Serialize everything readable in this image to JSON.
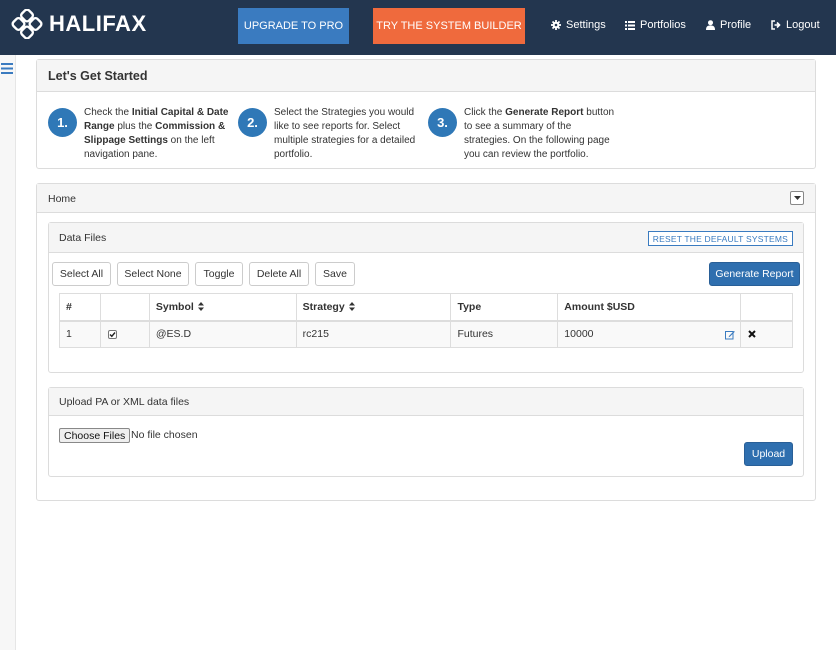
{
  "brand": {
    "name": "HALIFAX"
  },
  "navbar": {
    "upgrade_label": "UPGRADE TO PRO",
    "builder_label": "TRY THE SYSTEM BUILDER",
    "links": [
      {
        "label": "Settings",
        "icon": "gear-icon"
      },
      {
        "label": "Portfolios",
        "icon": "list-icon"
      },
      {
        "label": "Profile",
        "icon": "user-icon"
      },
      {
        "label": "Logout",
        "icon": "logout-icon"
      }
    ]
  },
  "getting_started": {
    "title": "Let's Get Started",
    "steps": [
      {
        "num": "1."
      },
      {
        "num": "2."
      },
      {
        "num": "3."
      }
    ]
  },
  "home": {
    "title": "Home"
  },
  "data_files": {
    "title": "Data Files",
    "reset_label": "RESET THE DEFAULT SYSTEMS",
    "toolbar": {
      "select_all": "Select All",
      "select_none": "Select None",
      "toggle": "Toggle",
      "delete_all": "Delete All",
      "save": "Save",
      "generate": "Generate Report"
    },
    "columns": [
      "#",
      "",
      "Symbol",
      "Strategy",
      "Type",
      "Amount $USD",
      ""
    ],
    "rows": [
      {
        "num": "1",
        "checked": true,
        "symbol": "@ES.D",
        "strategy": "rc215",
        "type": "Futures",
        "amount": "10000"
      }
    ]
  },
  "upload": {
    "title": "Upload PA or XML data files",
    "choose_label": "Choose Files",
    "no_file": "No file chosen",
    "upload_label": "Upload"
  },
  "colors": {
    "navbar": "#23364f",
    "accent_blue": "#3a7bc0",
    "accent_orange": "#ef6a3d",
    "step_circle": "#2f78b7"
  }
}
